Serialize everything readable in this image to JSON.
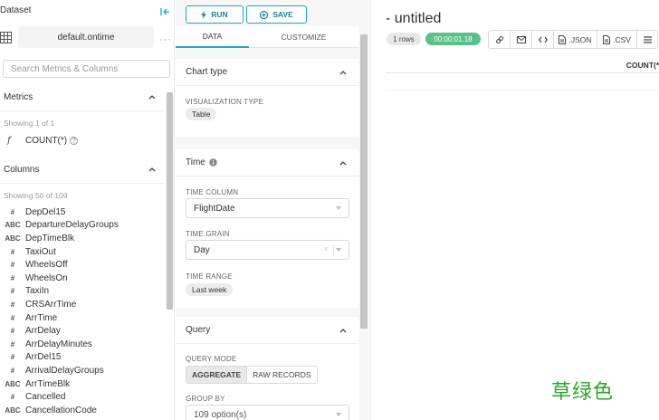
{
  "dataset": {
    "title": "Dataset",
    "name": "default.ontime",
    "more": "···",
    "search_placeholder": "Search Metrics & Columns"
  },
  "metrics": {
    "header": "Metrics",
    "showing": "Showing 1 of 1",
    "items": [
      {
        "type": "f",
        "name": "COUNT(*)"
      }
    ]
  },
  "columns": {
    "header": "Columns",
    "showing": "Showing 50 of 109",
    "items": [
      {
        "type": "#",
        "name": "DepDel15"
      },
      {
        "type": "ABC",
        "name": "DepartureDelayGroups"
      },
      {
        "type": "ABC",
        "name": "DepTimeBlk"
      },
      {
        "type": "#",
        "name": "TaxiOut"
      },
      {
        "type": "#",
        "name": "WheelsOff"
      },
      {
        "type": "#",
        "name": "WheelsOn"
      },
      {
        "type": "#",
        "name": "TaxiIn"
      },
      {
        "type": "#",
        "name": "CRSArrTime"
      },
      {
        "type": "#",
        "name": "ArrTime"
      },
      {
        "type": "#",
        "name": "ArrDelay"
      },
      {
        "type": "#",
        "name": "ArrDelayMinutes"
      },
      {
        "type": "#",
        "name": "ArrDel15"
      },
      {
        "type": "#",
        "name": "ArrivalDelayGroups"
      },
      {
        "type": "ABC",
        "name": "ArrTimeBlk"
      },
      {
        "type": "#",
        "name": "Cancelled"
      },
      {
        "type": "ABC",
        "name": "CancellationCode"
      }
    ]
  },
  "actions": {
    "run": "RUN",
    "save": "SAVE"
  },
  "tabs": {
    "data": "DATA",
    "customize": "CUSTOMIZE"
  },
  "chart_type": {
    "header": "Chart type",
    "viz_label": "VISUALIZATION TYPE",
    "viz_value": "Table"
  },
  "time": {
    "header": "Time",
    "column_label": "TIME COLUMN",
    "column_value": "FlightDate",
    "grain_label": "TIME GRAIN",
    "grain_value": "Day",
    "range_label": "TIME RANGE",
    "range_value": "Last week"
  },
  "query": {
    "header": "Query",
    "mode_label": "QUERY MODE",
    "mode_aggregate": "AGGREGATE",
    "mode_raw": "RAW RECORDS",
    "group_by_label": "GROUP BY",
    "group_by_placeholder": "109 option(s)"
  },
  "results": {
    "title": "- untitled",
    "rows_badge": "1 rows",
    "timer": "00:00:01.18",
    "json_label": ".JSON",
    "csv_label": ".CSV",
    "column_header": "COUNT(*)",
    "cell_value": "("
  },
  "watermark": "草绿色",
  "colors": {
    "accent": "#1fa8c9",
    "timer_bg": "#5ac189",
    "watermark": "#2aa52a"
  }
}
